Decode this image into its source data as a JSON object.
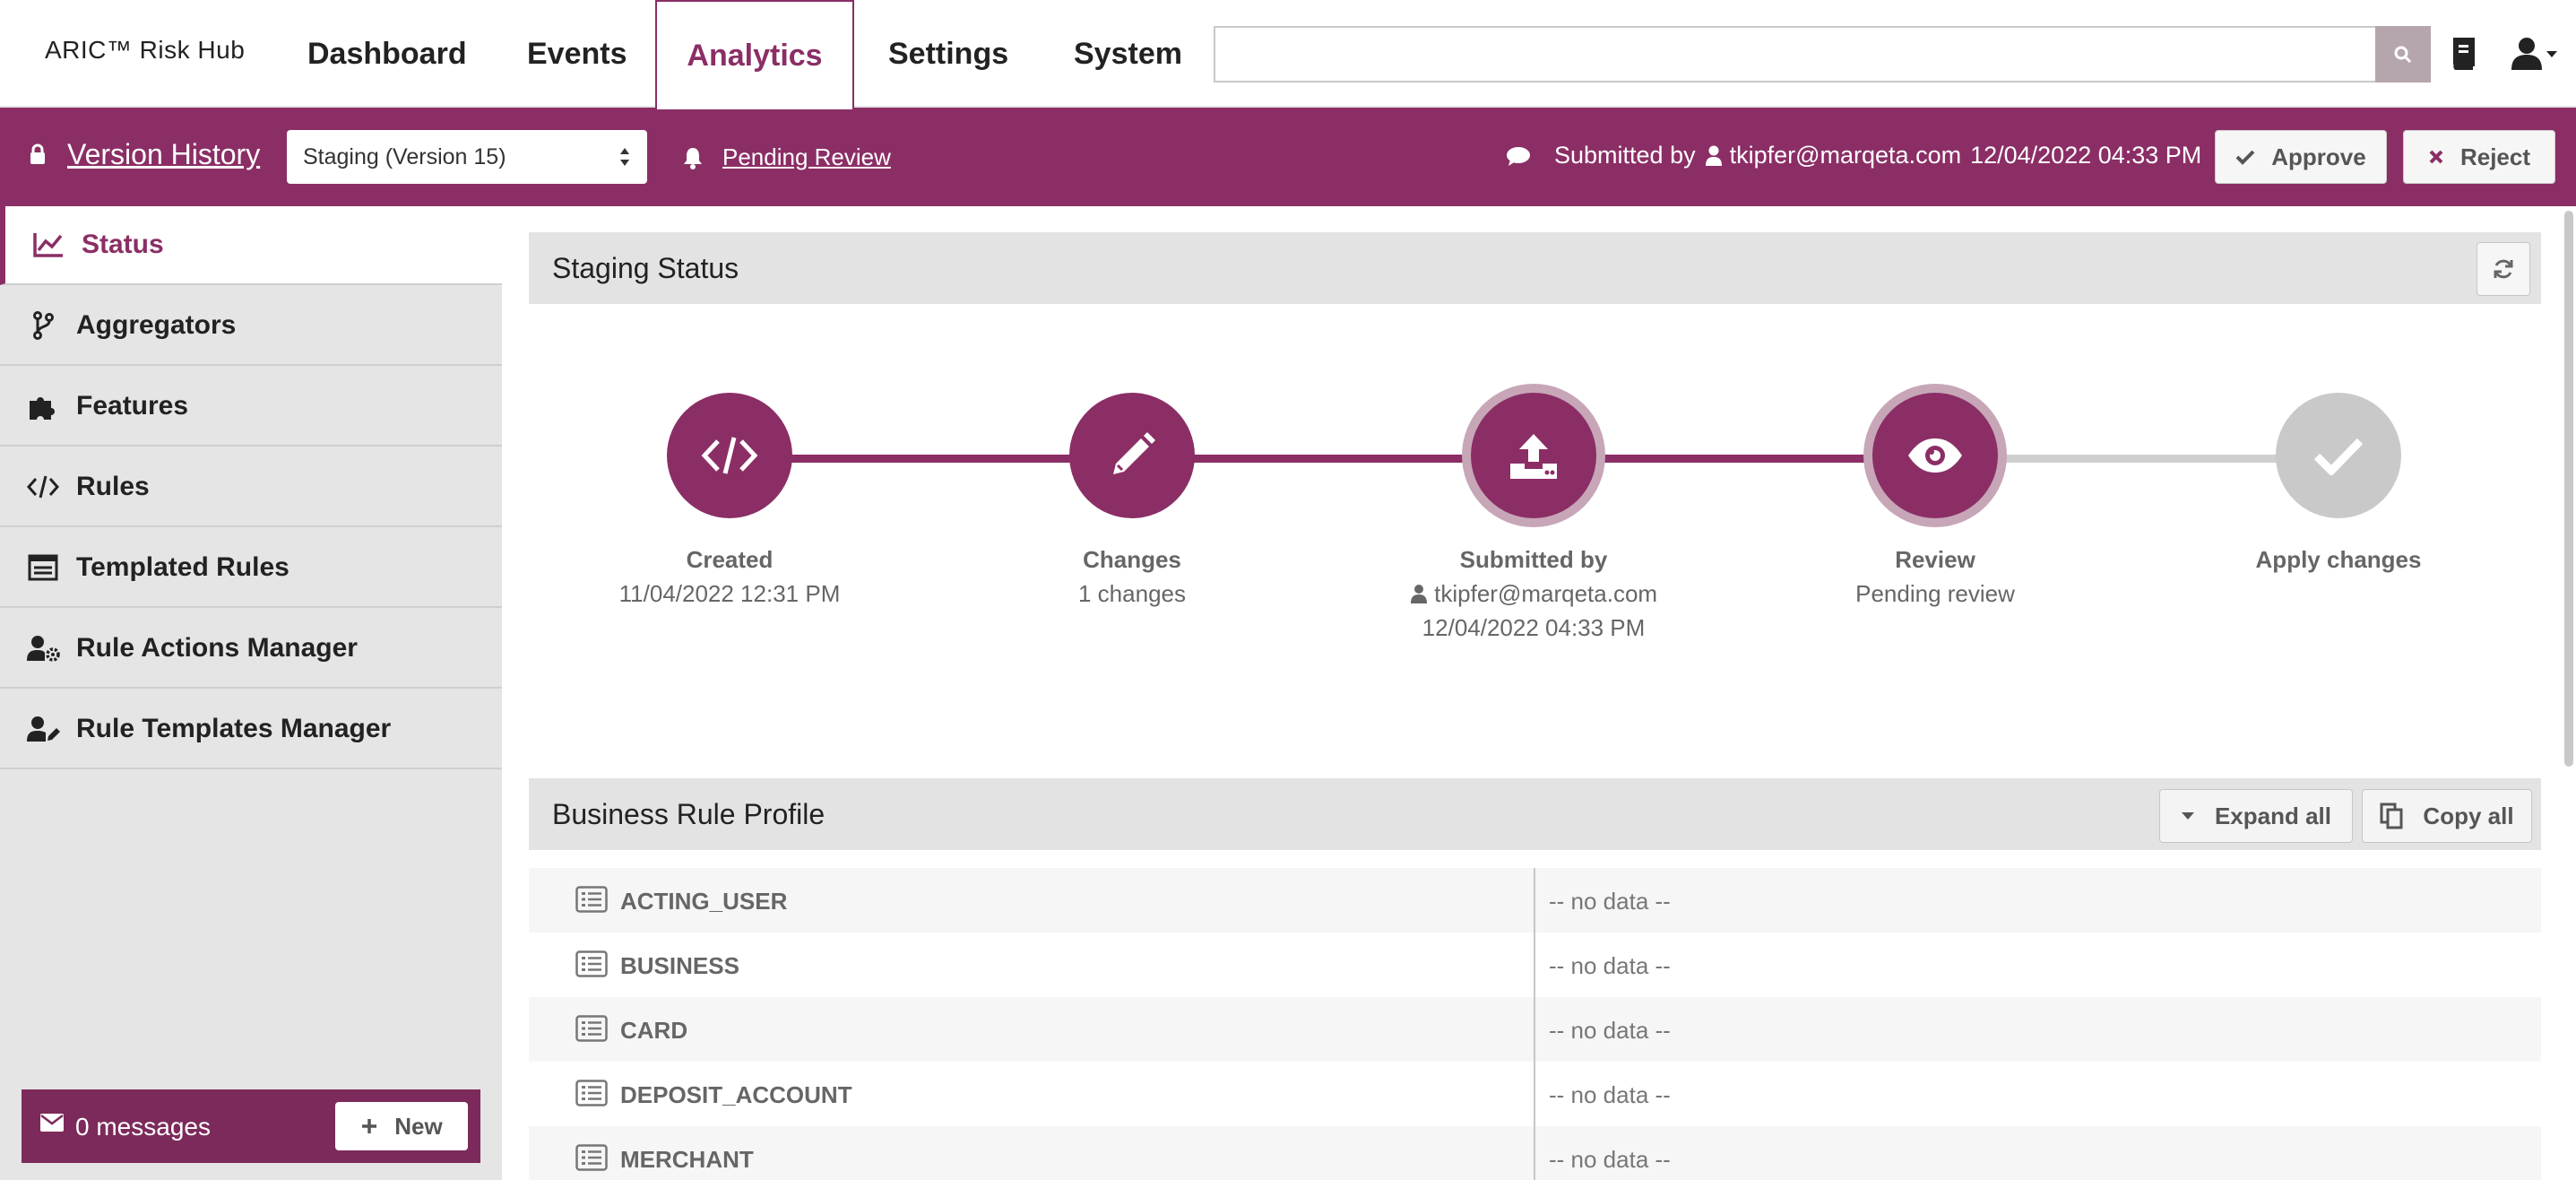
{
  "app": {
    "brand": "ARIC™ Risk Hub"
  },
  "nav": {
    "items": [
      "Dashboard",
      "Events",
      "Analytics",
      "Settings",
      "System"
    ],
    "active": "Analytics"
  },
  "search": {
    "value": "",
    "placeholder": ""
  },
  "version_bar": {
    "title": "Version History",
    "selected_version": "Staging (Version 15)",
    "pending_link": "Pending Review",
    "submitted_prefix": "Submitted by",
    "submitted_user": "tkipfer@marqeta.com",
    "submitted_time": "12/04/2022 04:33 PM",
    "approve_label": "Approve",
    "reject_label": "Reject"
  },
  "sidebar": {
    "items": [
      {
        "label": "Status",
        "icon": "chart-line-icon",
        "active": true
      },
      {
        "label": "Aggregators",
        "icon": "branch-icon"
      },
      {
        "label": "Features",
        "icon": "puzzle-icon"
      },
      {
        "label": "Rules",
        "icon": "code-icon"
      },
      {
        "label": "Templated Rules",
        "icon": "list-window-icon"
      },
      {
        "label": "Rule Actions Manager",
        "icon": "user-gear-icon"
      },
      {
        "label": "Rule Templates Manager",
        "icon": "user-edit-icon"
      }
    ],
    "messages": {
      "text": "0 messages",
      "new_label": "New"
    }
  },
  "staging": {
    "title": "Staging Status",
    "steps": [
      {
        "title": "Created",
        "lines": [
          "11/04/2022 12:31 PM"
        ],
        "icon": "code-icon",
        "state": "done"
      },
      {
        "title": "Changes",
        "lines": [
          "1 changes"
        ],
        "icon": "pencil-icon",
        "state": "done"
      },
      {
        "title": "Submitted by",
        "lines": [
          "tkipfer@marqeta.com",
          "12/04/2022 04:33 PM"
        ],
        "icon": "upload-icon",
        "state": "current"
      },
      {
        "title": "Review",
        "lines": [
          "Pending review"
        ],
        "icon": "eye-icon",
        "state": "current"
      },
      {
        "title": "Apply changes",
        "lines": [],
        "icon": "check-icon",
        "state": "todo"
      }
    ]
  },
  "profile": {
    "title": "Business Rule Profile",
    "expand_label": "Expand all",
    "copy_label": "Copy all",
    "rows": [
      {
        "name": "ACTING_USER",
        "value": "-- no data --"
      },
      {
        "name": "BUSINESS",
        "value": "-- no data --"
      },
      {
        "name": "CARD",
        "value": "-- no data --"
      },
      {
        "name": "DEPOSIT_ACCOUNT",
        "value": "-- no data --"
      },
      {
        "name": "MERCHANT",
        "value": "-- no data --"
      }
    ]
  },
  "colors": {
    "accent": "#8b2e66",
    "inactive": "#c9c9c9",
    "sidebar_bg": "#e5e5e5"
  }
}
